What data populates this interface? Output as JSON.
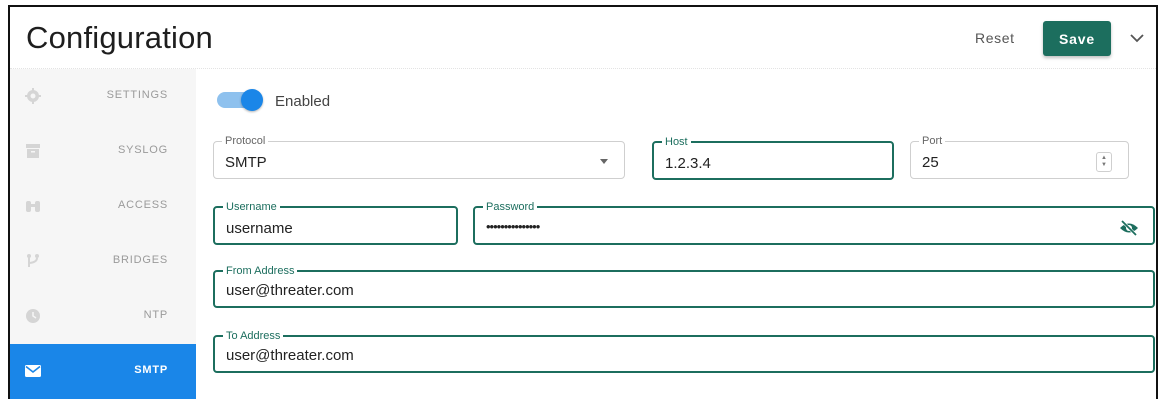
{
  "header": {
    "title": "Configuration",
    "reset_label": "Reset",
    "save_label": "Save"
  },
  "sidebar": {
    "items": [
      {
        "label": "SETTINGS",
        "icon": "gear-icon"
      },
      {
        "label": "SYSLOG",
        "icon": "archive-icon"
      },
      {
        "label": "ACCESS",
        "icon": "binoculars-icon"
      },
      {
        "label": "BRIDGES",
        "icon": "bridge-icon"
      },
      {
        "label": "NTP",
        "icon": "clock-icon"
      },
      {
        "label": "SMTP",
        "icon": "mail-icon",
        "active": true
      }
    ]
  },
  "form": {
    "enabled_label": "Enabled",
    "enabled": true,
    "protocol": {
      "label": "Protocol",
      "value": "SMTP"
    },
    "host": {
      "label": "Host",
      "value": "1.2.3.4"
    },
    "port": {
      "label": "Port",
      "value": "25"
    },
    "username": {
      "label": "Username",
      "value": "username"
    },
    "password": {
      "label": "Password",
      "value": "•••••••••••••••"
    },
    "from_address": {
      "label": "From Address",
      "value": "user@threater.com"
    },
    "to_address": {
      "label": "To Address",
      "value": "user@threater.com"
    }
  },
  "colors": {
    "primary": "#1c6e5e",
    "accent": "#1a86e8",
    "toggle_track": "#8ec1ee"
  }
}
